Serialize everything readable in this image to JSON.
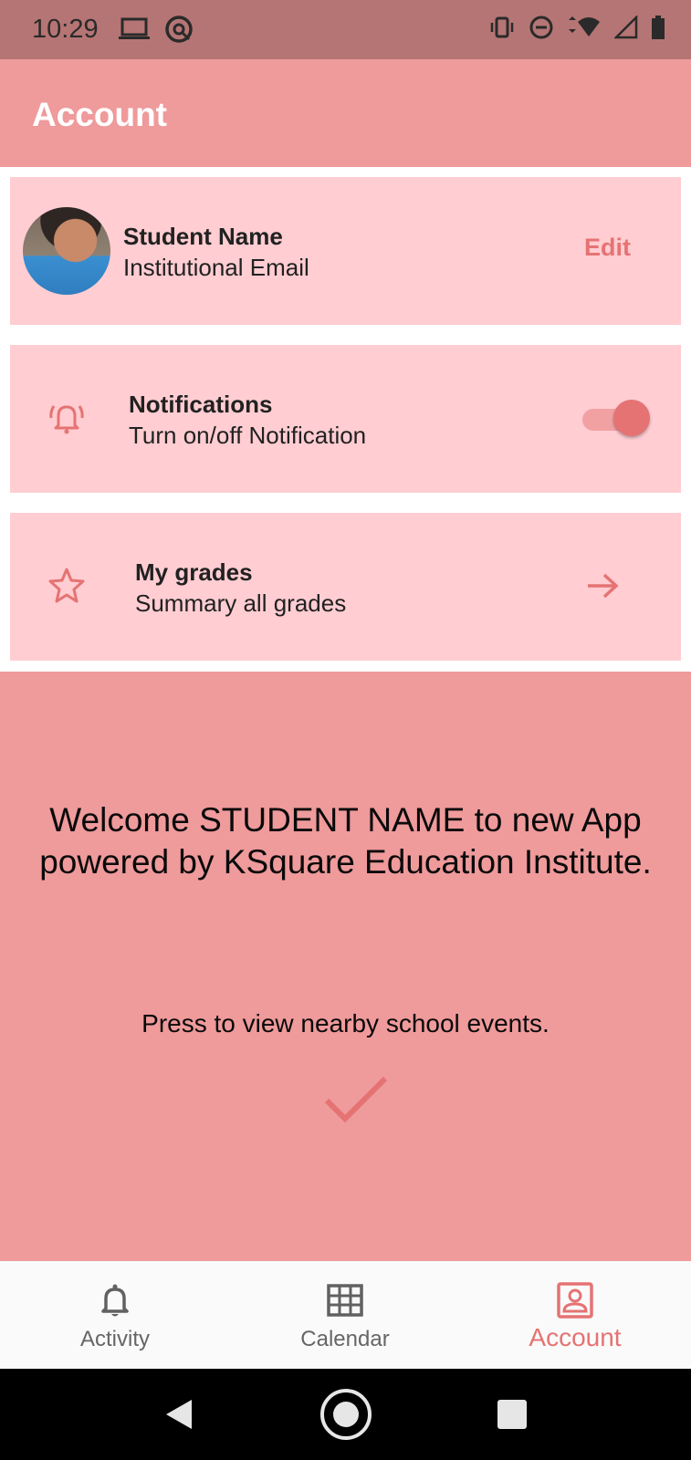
{
  "status_bar": {
    "time": "10:29"
  },
  "app_bar": {
    "title": "Account"
  },
  "profile_card": {
    "name": "Student Name",
    "email": "Institutional Email",
    "edit_label": "Edit"
  },
  "notifications_card": {
    "title": "Notifications",
    "subtitle": "Turn on/off Notification",
    "toggle_on": true
  },
  "grades_card": {
    "title": "My grades",
    "subtitle": "Summary all grades"
  },
  "welcome": {
    "line1": "Welcome STUDENT NAME to new App",
    "line2": "powered by KSquare Education Institute.",
    "events_prompt": "Press to view nearby school events."
  },
  "bottom_nav": {
    "items": [
      {
        "label": "Activity",
        "icon": "bell-icon",
        "active": false
      },
      {
        "label": "Calendar",
        "icon": "calendar-grid-icon",
        "active": false
      },
      {
        "label": "Account",
        "icon": "account-box-icon",
        "active": true
      }
    ]
  },
  "colors": {
    "status_bar": "#b57574",
    "primary": "#ef9a9b",
    "card": "#ffcdd2",
    "accent": "#e57373"
  }
}
